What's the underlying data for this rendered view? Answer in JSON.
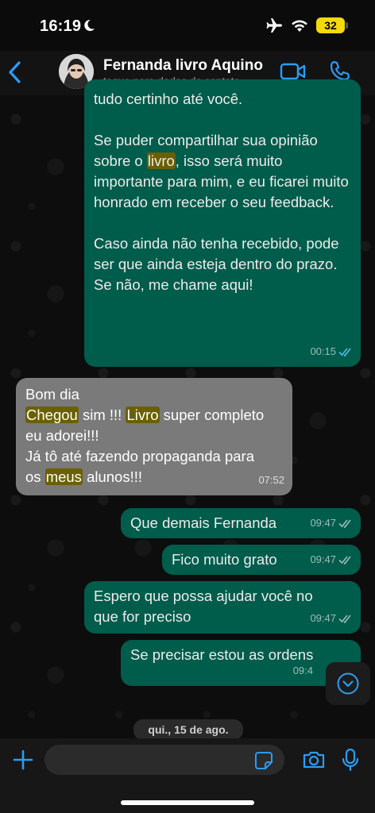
{
  "status": {
    "time": "16:19",
    "battery": "32"
  },
  "header": {
    "contact_name": "Fernanda livro Aquino",
    "contact_subtitle": "toque para dados do contato"
  },
  "messages": [
    {
      "direction": "out",
      "top_fragment": "tudo certinho até você.",
      "p2_a": "Se puder compartilhar sua opinião sobre o ",
      "p2_hl": "livro",
      "p2_b": ", isso será muito importante para mim, e eu ficarei muito honrado em receber o seu feedback.",
      "p3": "Caso ainda não tenha recebido, pode ser que ainda esteja dentro do prazo. Se não, me chame aqui!",
      "time": "00:15"
    },
    {
      "direction": "in",
      "line1": "Bom dia",
      "hl1": "Chegou",
      "t1": " sim !!! ",
      "hl2": "Livro",
      "t2": " super completo eu adorei!!!",
      "line3": "Já tô até fazendo propaganda para",
      "t3": "os ",
      "hl3": "meus",
      "t4": " alunos!!!",
      "time": "07:52"
    },
    {
      "direction": "out",
      "text": "Que demais Fernanda",
      "time": "09:47"
    },
    {
      "direction": "out",
      "text": "Fico muito grato",
      "time": "09:47"
    },
    {
      "direction": "out",
      "text": "Espero que possa ajudar você no que for preciso",
      "time": "09:47"
    },
    {
      "direction": "out",
      "text": "Se precisar estou as ordens",
      "time": "09:4"
    }
  ],
  "date_chip": "qui., 15 de ago.",
  "input": {
    "placeholder": ""
  },
  "colors": {
    "outgoing": "#005c4b",
    "incoming": "#7a7a7a",
    "accent": "#2a9df4",
    "highlight": "#6b6000"
  },
  "icons": [
    "moon-icon",
    "airplane-icon",
    "wifi-icon",
    "back-chevron-icon",
    "video-call-icon",
    "phone-icon",
    "double-check-icon",
    "chevron-down-icon",
    "plus-icon",
    "sticker-icon",
    "camera-icon",
    "mic-icon"
  ]
}
